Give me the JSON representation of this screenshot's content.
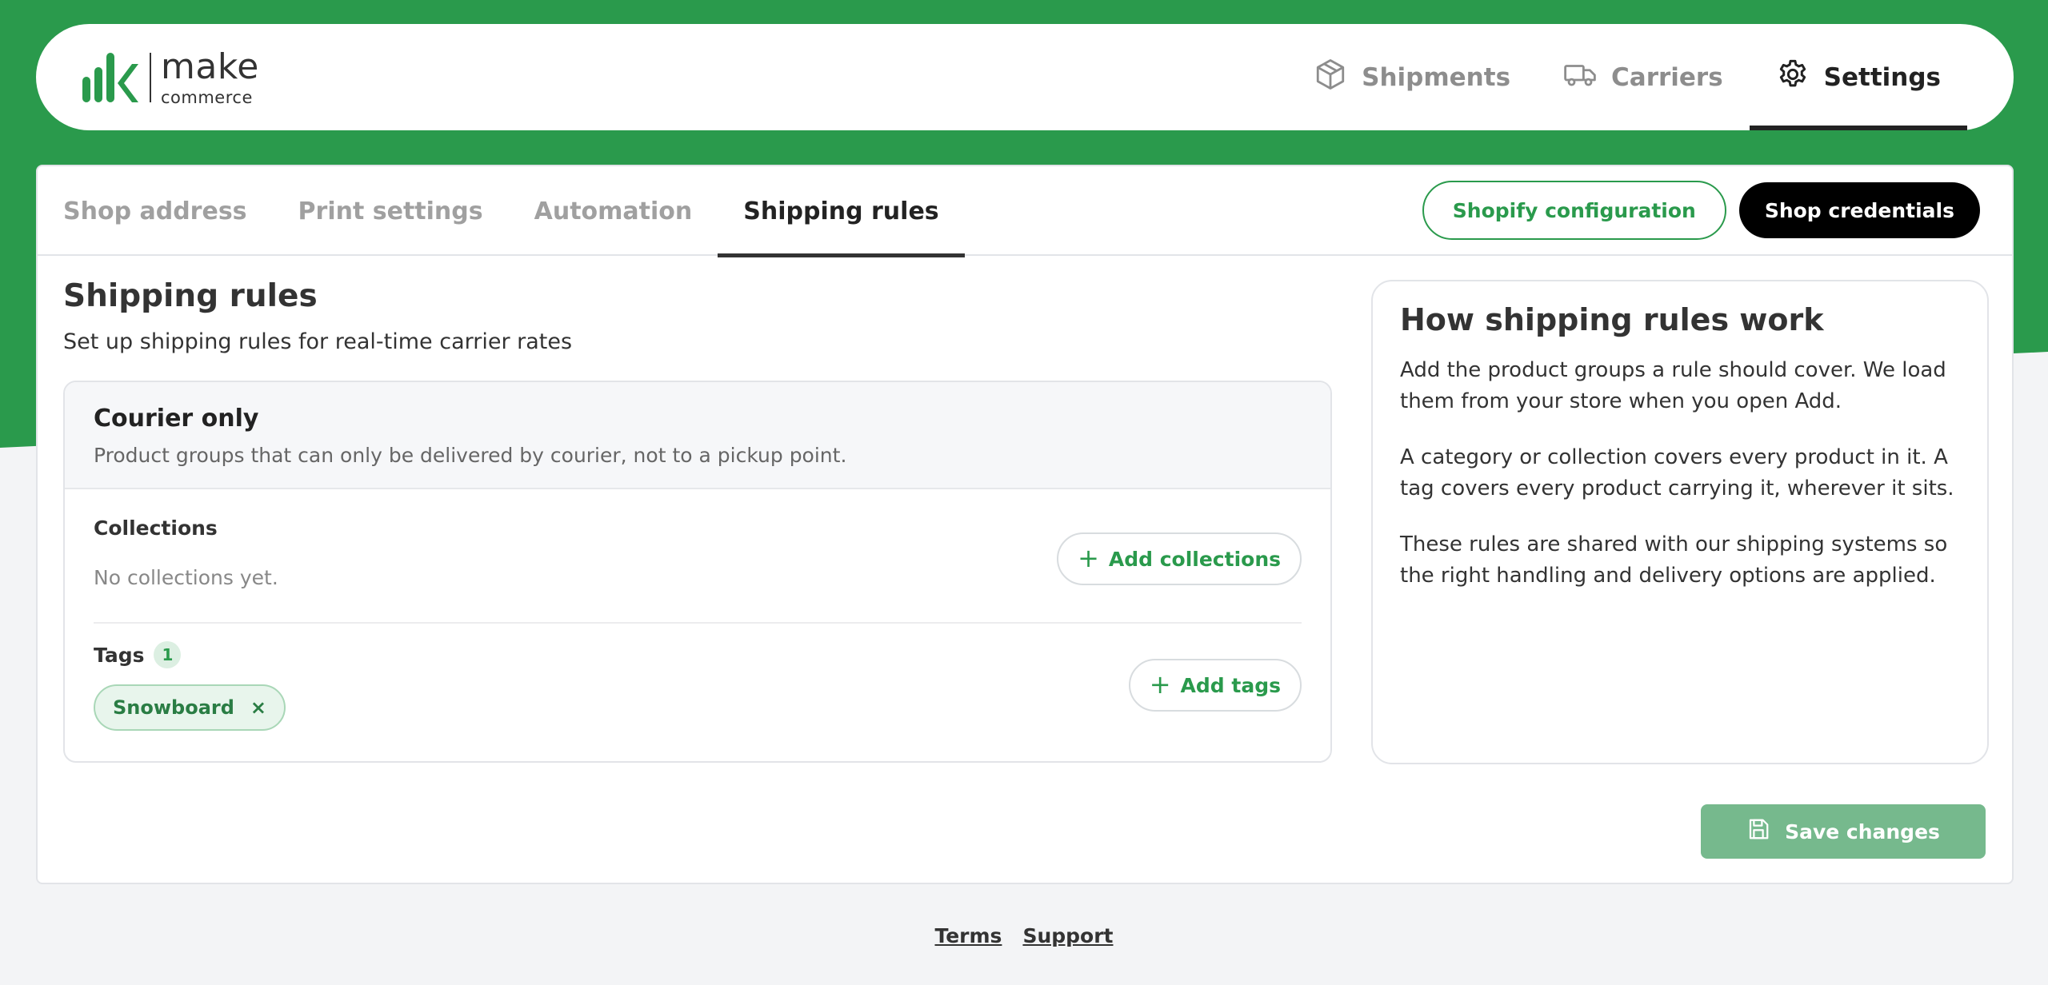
{
  "brand": {
    "name": "make",
    "subname": "commerce",
    "color": "#2a9a4c"
  },
  "nav": {
    "items": [
      {
        "label": "Shipments",
        "icon": "package-icon"
      },
      {
        "label": "Carriers",
        "icon": "truck-icon"
      },
      {
        "label": "Settings",
        "icon": "gear-icon",
        "active": true
      }
    ]
  },
  "tabs": [
    {
      "label": "Shop address"
    },
    {
      "label": "Print settings"
    },
    {
      "label": "Automation"
    },
    {
      "label": "Shipping rules",
      "active": true
    }
  ],
  "actions": {
    "shopify_config": "Shopify configuration",
    "shop_credentials": "Shop credentials"
  },
  "main": {
    "title": "Shipping rules",
    "subtitle": "Set up shipping rules for real-time carrier rates"
  },
  "rule": {
    "title": "Courier only",
    "description": "Product groups that can only be delivered by courier, not to a pickup point.",
    "collections": {
      "label": "Collections",
      "empty": "No collections yet.",
      "add_label": "Add collections"
    },
    "tags": {
      "label": "Tags",
      "count": "1",
      "items": [
        "Snowboard"
      ],
      "remove_glyph": "×",
      "add_label": "Add tags"
    }
  },
  "info": {
    "title": "How shipping rules work",
    "paragraphs": [
      "Add the product groups a rule should cover. We load them from your store when you open Add.",
      "A category or collection covers every product in it. A tag covers every product carrying it, wherever it sits.",
      "These rules are shared with our shipping systems so the right handling and delivery options are applied."
    ]
  },
  "save": {
    "label": "Save changes",
    "icon": "save-icon"
  },
  "footer": {
    "links": [
      "Terms",
      "Support"
    ]
  }
}
